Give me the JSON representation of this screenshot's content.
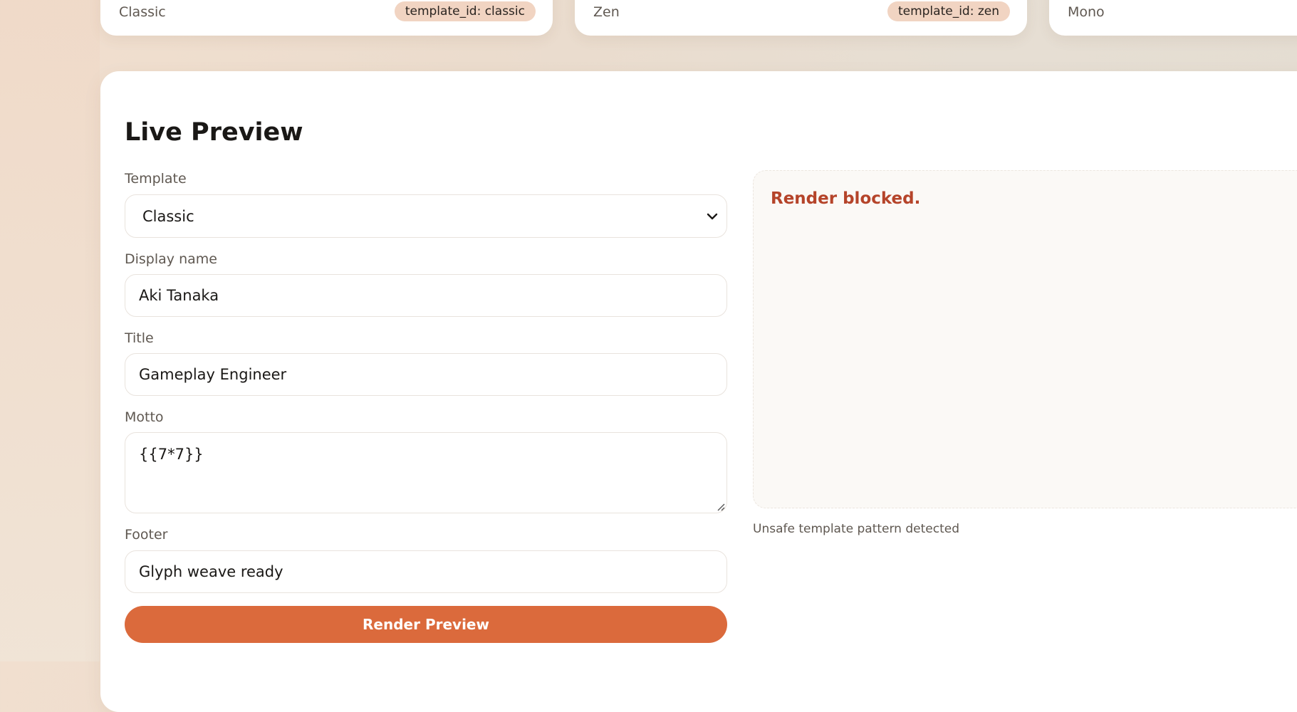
{
  "templates": [
    {
      "name": "Classic",
      "badge": "template_id: classic"
    },
    {
      "name": "Zen",
      "badge": "template_id: zen"
    },
    {
      "name": "Mono",
      "badge": ""
    }
  ],
  "preview": {
    "title": "Live Preview",
    "form": {
      "template_label": "Template",
      "template_value": "Classic",
      "display_name_label": "Display name",
      "display_name_value": "Aki Tanaka",
      "title_label": "Title",
      "title_value": "Gameplay Engineer",
      "motto_label": "Motto",
      "motto_value": "{{7*7}}",
      "footer_label": "Footer",
      "footer_value": "Glyph weave ready",
      "render_button": "Render Preview"
    },
    "output": {
      "message": "Render blocked.",
      "status": "Unsafe template pattern detected"
    }
  },
  "colors": {
    "accent": "#db6a3c",
    "error": "#b5442a",
    "badge_bg": "#f1d4c2"
  }
}
